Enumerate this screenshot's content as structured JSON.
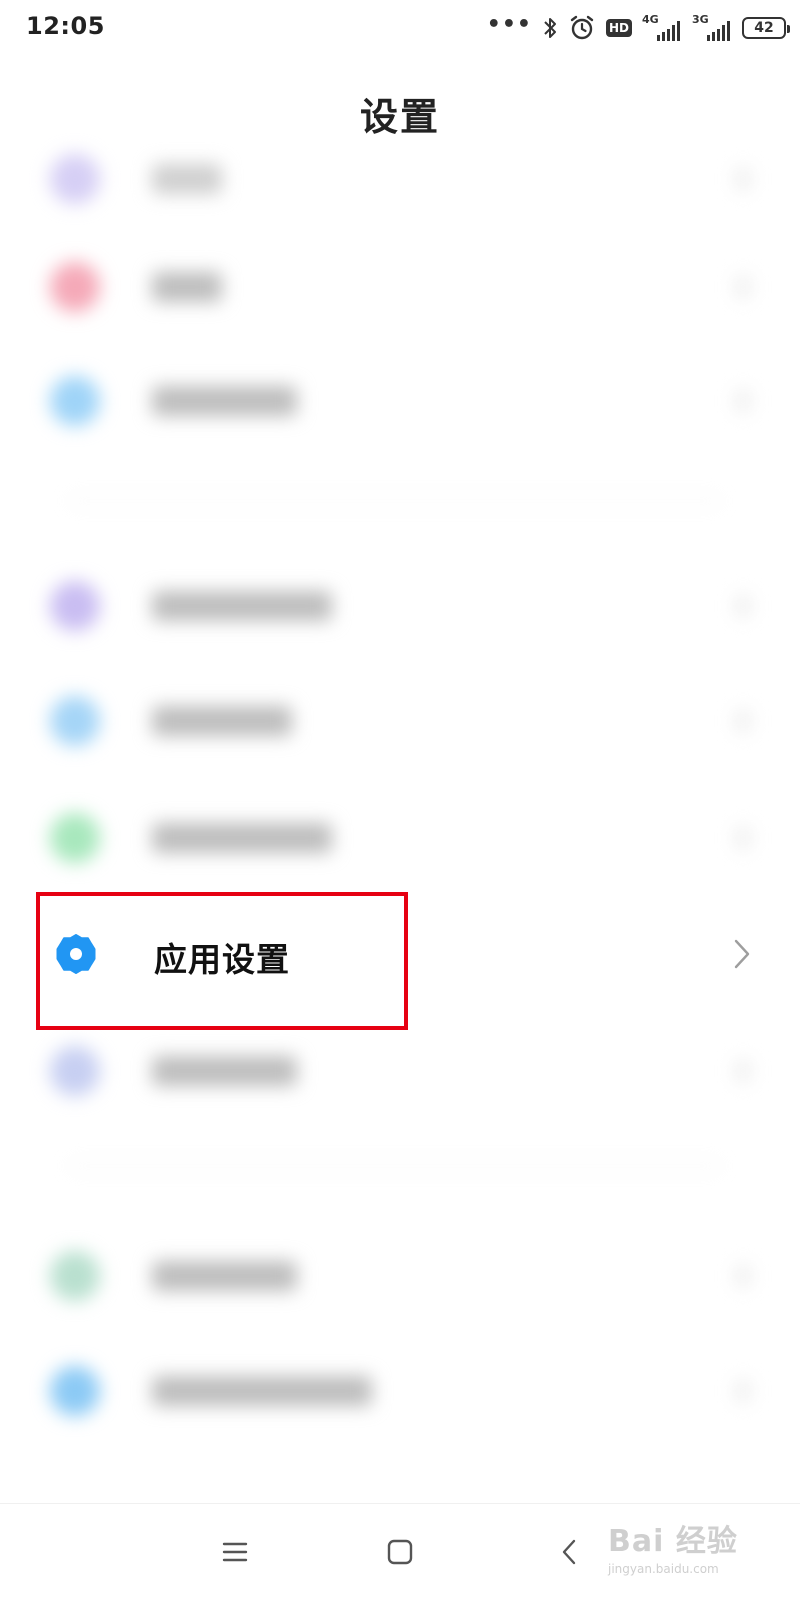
{
  "status_bar": {
    "time": "12:05",
    "dots": "•••",
    "hd": "HD",
    "network_1": "4G",
    "network_2": "3G",
    "battery": "42"
  },
  "header": {
    "title": "设置"
  },
  "highlighted_item": {
    "label": "应用设置",
    "icon": "gear-icon",
    "icon_color": "#2196f3"
  },
  "highlight_color": "#e60012",
  "nav_bar": {
    "menu_icon": "menu-icon",
    "home_icon": "home-icon",
    "back_icon": "back-icon"
  },
  "watermark": {
    "logo": "Bai 经验",
    "sub": "jingyan.baidu.com"
  }
}
